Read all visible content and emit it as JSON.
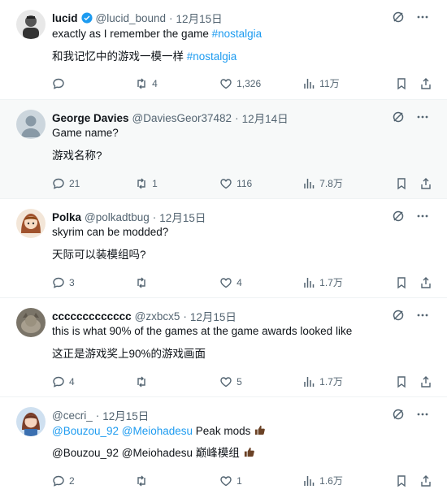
{
  "colors": {
    "link": "#1d9bf0",
    "muted": "#536471",
    "verified": "#1d9bf0"
  },
  "tweets": [
    {
      "name": "lucid",
      "verified": true,
      "handle": "@lucid_bound",
      "dot": "·",
      "date": "12月15日",
      "text": "exactly as I remember the game ",
      "hashtag": "#nostalgia",
      "translation": "和我记忆中的游戏一模一样 ",
      "translation_hashtag": "#nostalgia",
      "replies": "",
      "retweets": "4",
      "likes": "1,326",
      "views": "11万"
    },
    {
      "name": "George Davies",
      "handle": "@DaviesGeor37482",
      "dot": "·",
      "date": "12月14日",
      "text": "Game name?",
      "translation": "游戏名称?",
      "replies": "21",
      "retweets": "1",
      "likes": "116",
      "views": "7.8万"
    },
    {
      "name": "Polka",
      "handle": "@polkadtbug",
      "dot": "·",
      "date": "12月15日",
      "text": "skyrim can be modded?",
      "translation": "天际可以装模组吗?",
      "replies": "3",
      "retweets": "",
      "likes": "4",
      "views": "1.7万"
    },
    {
      "name": "ccccccccccccc",
      "handle": "@zxbcx5",
      "dot": "·",
      "date": "12月15日",
      "text": "this is what 90% of the games at the game awards looked like",
      "translation": "这正是游戏奖上90%的游戏画面",
      "replies": "4",
      "retweets": "",
      "likes": "5",
      "views": "1.7万"
    },
    {
      "name": "",
      "handle": "@cecri_",
      "dot": "·",
      "date": "12月15日",
      "mention1": "@Bouzou_92",
      "mention2": "@Meiohadesu",
      "text": " Peak mods",
      "translation_mentions": "@Bouzou_92 @Meiohadesu ",
      "translation": "巅峰模组",
      "replies": "2",
      "retweets": "",
      "likes": "1",
      "views": "1.6万"
    }
  ]
}
